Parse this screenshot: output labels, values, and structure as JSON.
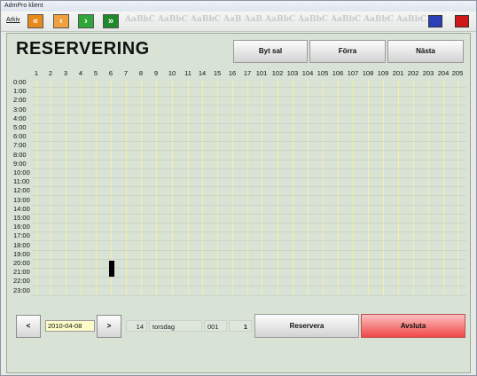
{
  "window": {
    "title": "AdmPro klient"
  },
  "menu": {
    "arkiv": "Arkiv"
  },
  "toolbar": {
    "first_glyph": "«",
    "prev_glyph": "‹",
    "next_glyph": "›",
    "last_glyph": "»",
    "ghost_text": "AaBbC AaBbC AaBbC AaB AaB AaBbC AaBbC AaBbC AaBbC AaBbC"
  },
  "colors": {
    "orange": "#e88a1a",
    "green": "#1f8a2a",
    "minimize": "#2a3fb8",
    "close": "#d11818",
    "avsluta": "#f25a5a"
  },
  "page": {
    "title": "RESERVERING"
  },
  "buttons": {
    "byt_sal": "Byt sal",
    "forra": "Förra",
    "nasta": "Nästa",
    "prev": "<",
    "next": ">",
    "reservera": "Reservera",
    "avsluta": "Avsluta"
  },
  "columns": [
    "1",
    "2",
    "3",
    "4",
    "5",
    "6",
    "7",
    "8",
    "9",
    "10",
    "11",
    "14",
    "15",
    "16",
    "17",
    "101",
    "102",
    "103",
    "104",
    "105",
    "106",
    "107",
    "108",
    "109",
    "201",
    "202",
    "203",
    "204",
    "205"
  ],
  "times": [
    "0:00",
    "1:00",
    "2:00",
    "3:00",
    "4:00",
    "5:00",
    "6:00",
    "7:00",
    "8:00",
    "9:00",
    "10:00",
    "11:00",
    "12:00",
    "13:00",
    "14:00",
    "15:00",
    "16:00",
    "17:00",
    "18:00",
    "19:00",
    "20:00",
    "21:00",
    "22:00",
    "23:00"
  ],
  "status": {
    "date": "2010-04-08",
    "week": "14",
    "weekday": "torsdag",
    "room": "001",
    "count": "1"
  }
}
